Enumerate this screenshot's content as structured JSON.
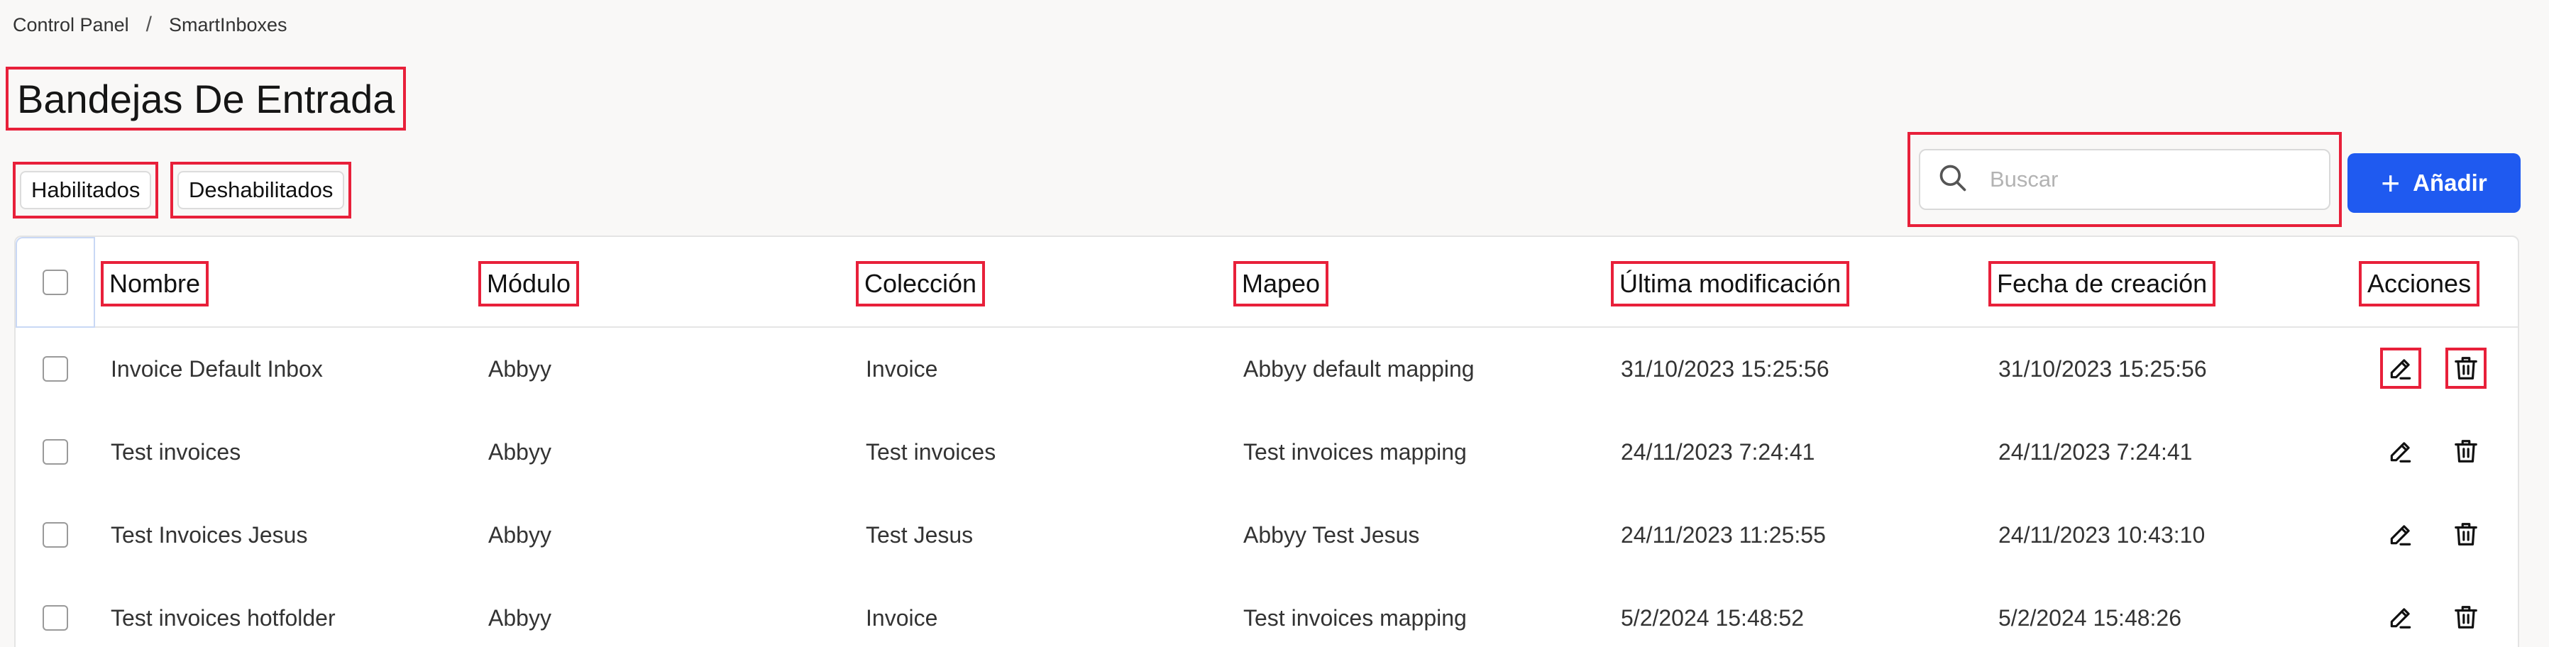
{
  "breadcrumb": {
    "root": "Control Panel",
    "separator": "/",
    "current": "SmartInboxes"
  },
  "page_title": "Bandejas De Entrada",
  "filters": {
    "enabled": "Habilitados",
    "disabled": "Deshabilitados"
  },
  "search": {
    "placeholder": "Buscar",
    "value": "",
    "icon": "search-icon"
  },
  "add_button": {
    "label": "Añadir",
    "icon": "plus-icon",
    "color": "#1f5af0"
  },
  "table": {
    "columns": [
      "Nombre",
      "Módulo",
      "Colección",
      "Mapeo",
      "Última modificación",
      "Fecha de creación",
      "Acciones"
    ],
    "rows": [
      {
        "name": "Invoice Default Inbox",
        "module": "Abbyy",
        "collection": "Invoice",
        "mapping": "Abbyy default mapping",
        "modified": "31/10/2023 15:25:56",
        "created": "31/10/2023 15:25:56"
      },
      {
        "name": "Test invoices",
        "module": "Abbyy",
        "collection": "Test invoices",
        "mapping": "Test invoices mapping",
        "modified": "24/11/2023 7:24:41",
        "created": "24/11/2023 7:24:41"
      },
      {
        "name": "Test Invoices Jesus",
        "module": "Abbyy",
        "collection": "Test Jesus",
        "mapping": "Abbyy Test Jesus",
        "modified": "24/11/2023 11:25:55",
        "created": "24/11/2023 10:43:10"
      },
      {
        "name": "Test invoices hotfolder",
        "module": "Abbyy",
        "collection": "Invoice",
        "mapping": "Test invoices mapping",
        "modified": "5/2/2024 15:48:52",
        "created": "5/2/2024 15:48:26"
      }
    ],
    "action_icons": [
      "edit-icon",
      "trash-icon"
    ]
  },
  "annotation_color": "#e8203a"
}
